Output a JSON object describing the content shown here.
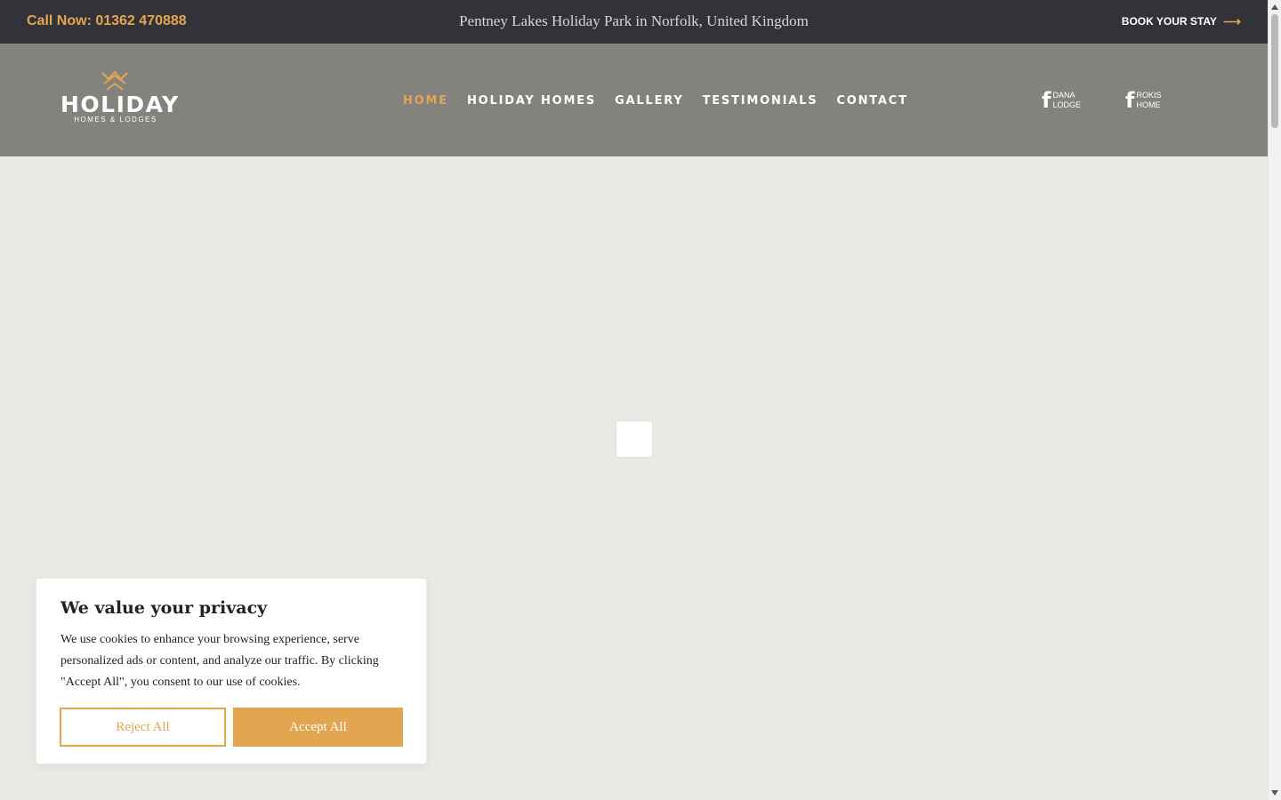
{
  "topbar": {
    "call_text": "Call Now: 01362 470888",
    "location": "Pentney Lakes Holiday Park in Norfolk, United Kingdom",
    "book_label": "BOOK YOUR STAY",
    "book_icon": "arrow-right-icon"
  },
  "logo": {
    "word": "HOLIDAY",
    "subtitle": "HOMES & LODGES",
    "icon": "crown-icon"
  },
  "nav": {
    "items": [
      {
        "label": "HOME",
        "active": true
      },
      {
        "label": "HOLIDAY HOMES",
        "active": false
      },
      {
        "label": "GALLERY",
        "active": false
      },
      {
        "label": "TESTIMONIALS",
        "active": false
      },
      {
        "label": "CONTACT",
        "active": false
      }
    ]
  },
  "social": [
    {
      "icon": "facebook-icon",
      "line1": "DANA",
      "line2": "LODGE"
    },
    {
      "icon": "facebook-icon",
      "line1": "ROKIS",
      "line2": "HOME"
    }
  ],
  "cookie": {
    "title": "We value your privacy",
    "body": "We use cookies to enhance your browsing experience, serve personalized ads or content, and analyze our traffic. By clicking \"Accept All\", you consent to our use of cookies.",
    "reject_label": "Reject All",
    "accept_label": "Accept All"
  },
  "colors": {
    "accent": "#e3a650",
    "topbar_bg": "#333238",
    "header_bg": "#83827e",
    "page_bg": "#eae9e5"
  }
}
